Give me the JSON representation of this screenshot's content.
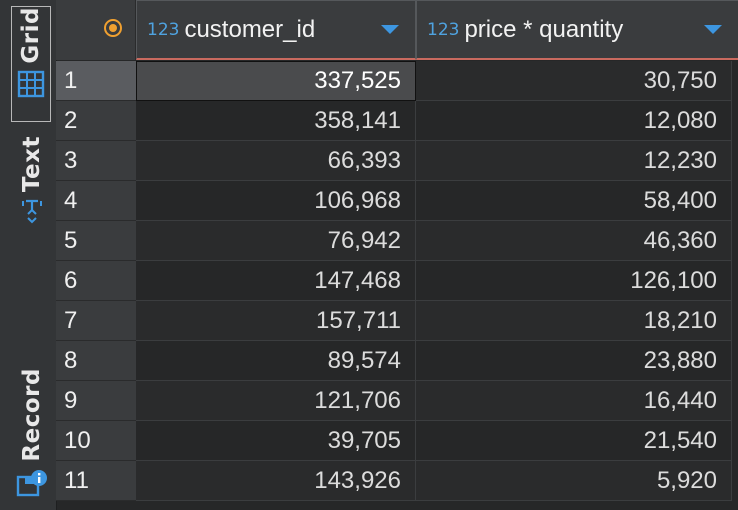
{
  "sidebar": {
    "grid_label": "Grid",
    "text_label": "Text",
    "record_label": "Record"
  },
  "columns": [
    {
      "type": "123",
      "name": "customer_id"
    },
    {
      "type": "123",
      "name": "price * quantity"
    }
  ],
  "rows": [
    {
      "num": "1",
      "customer_id": "337,525",
      "total": "30,750"
    },
    {
      "num": "2",
      "customer_id": "358,141",
      "total": "12,080"
    },
    {
      "num": "3",
      "customer_id": "66,393",
      "total": "12,230"
    },
    {
      "num": "4",
      "customer_id": "106,968",
      "total": "58,400"
    },
    {
      "num": "5",
      "customer_id": "76,942",
      "total": "46,360"
    },
    {
      "num": "6",
      "customer_id": "147,468",
      "total": "126,100"
    },
    {
      "num": "7",
      "customer_id": "157,711",
      "total": "18,210"
    },
    {
      "num": "8",
      "customer_id": "89,574",
      "total": "23,880"
    },
    {
      "num": "9",
      "customer_id": "121,706",
      "total": "16,440"
    },
    {
      "num": "10",
      "customer_id": "39,705",
      "total": "21,540"
    },
    {
      "num": "11",
      "customer_id": "143,926",
      "total": "5,920"
    }
  ],
  "colors": {
    "type_tag": "#4fa3e0",
    "sort_arrow": "#3d96e0",
    "header_underline": "#c96a5f",
    "record_indicator": "#f0a030"
  }
}
